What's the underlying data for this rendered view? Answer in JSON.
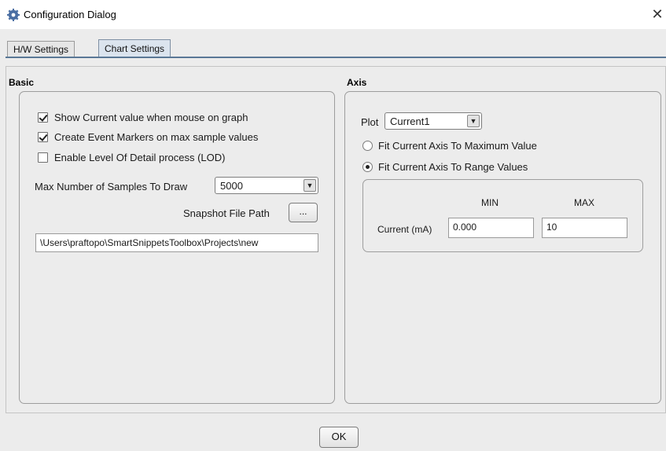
{
  "window": {
    "title": "Configuration Dialog",
    "close_symbol": "✕",
    "icon": "gear-icon"
  },
  "tabs": [
    {
      "label": "H/W Settings",
      "active": false
    },
    {
      "label": "Chart Settings",
      "active": true
    }
  ],
  "basic": {
    "title": "Basic",
    "show_current_value": {
      "label": "Show Current value when mouse on graph",
      "checked": true
    },
    "create_event_markers": {
      "label": "Create Event Markers on max sample values",
      "checked": true
    },
    "enable_lod": {
      "label": "Enable Level Of Detail process (LOD)",
      "checked": false
    },
    "max_samples": {
      "label": "Max Number of Samples To Draw",
      "value": "5000"
    },
    "snapshot": {
      "label": "Snapshot File Path",
      "button_label": "...",
      "path_value": "\\Users\\praftopo\\SmartSnippetsToolbox\\Projects\\new"
    }
  },
  "axis": {
    "title": "Axis",
    "plot": {
      "label": "Plot",
      "value": "Current1"
    },
    "fit_max": {
      "label": "Fit Current Axis To Maximum Value",
      "checked": false
    },
    "fit_range": {
      "label": "Fit Current Axis To Range Values",
      "checked": true
    },
    "range": {
      "min_header": "MIN",
      "max_header": "MAX",
      "row_label": "Current (mA)",
      "min_value": "0.000",
      "max_value": "10"
    }
  },
  "footer": {
    "ok_label": "OK"
  },
  "colors": {
    "tab_accent": "#5a7896",
    "dialog_bg": "#ececec"
  }
}
